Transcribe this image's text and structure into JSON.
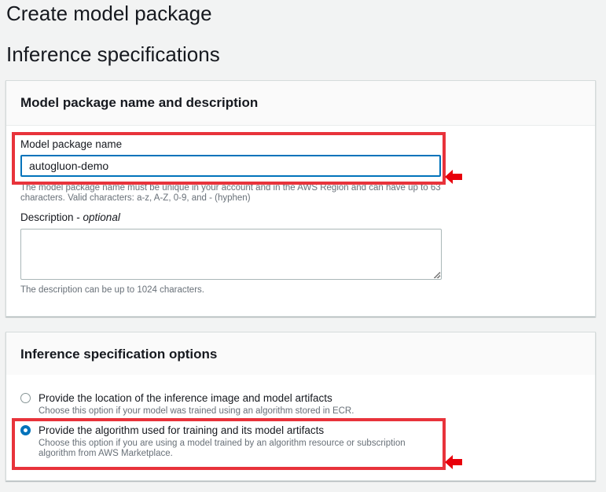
{
  "page": {
    "title": "Create model package",
    "section_title": "Inference specifications"
  },
  "name_panel": {
    "header": "Model package name and description",
    "name_label": "Model package name",
    "name_value": "autogluon-demo",
    "name_hint": "The model package name must be unique in your account and in the AWS Region and can have up to 63 characters. Valid characters: a-z, A-Z, 0-9, and - (hyphen)",
    "description_label": "Description",
    "description_optional": "optional",
    "description_separator": " - ",
    "description_value": "",
    "description_hint": "The description can be up to 1024 characters."
  },
  "options_panel": {
    "header": "Inference specification options",
    "options": [
      {
        "label": "Provide the location of the inference image and model artifacts",
        "description": "Choose this option if your model was trained using an algorithm stored in ECR.",
        "selected": false
      },
      {
        "label": "Provide the algorithm used for training and its model artifacts",
        "description": "Choose this option if you are using a model trained by an algorithm resource or subscription algorithm from AWS Marketplace.",
        "selected": true
      }
    ]
  },
  "annotations": {
    "highlight_color": "#e8333b",
    "arrow_icon": "left-arrow-icon"
  },
  "colors": {
    "accent": "#0073bb",
    "background": "#f2f3f3"
  }
}
